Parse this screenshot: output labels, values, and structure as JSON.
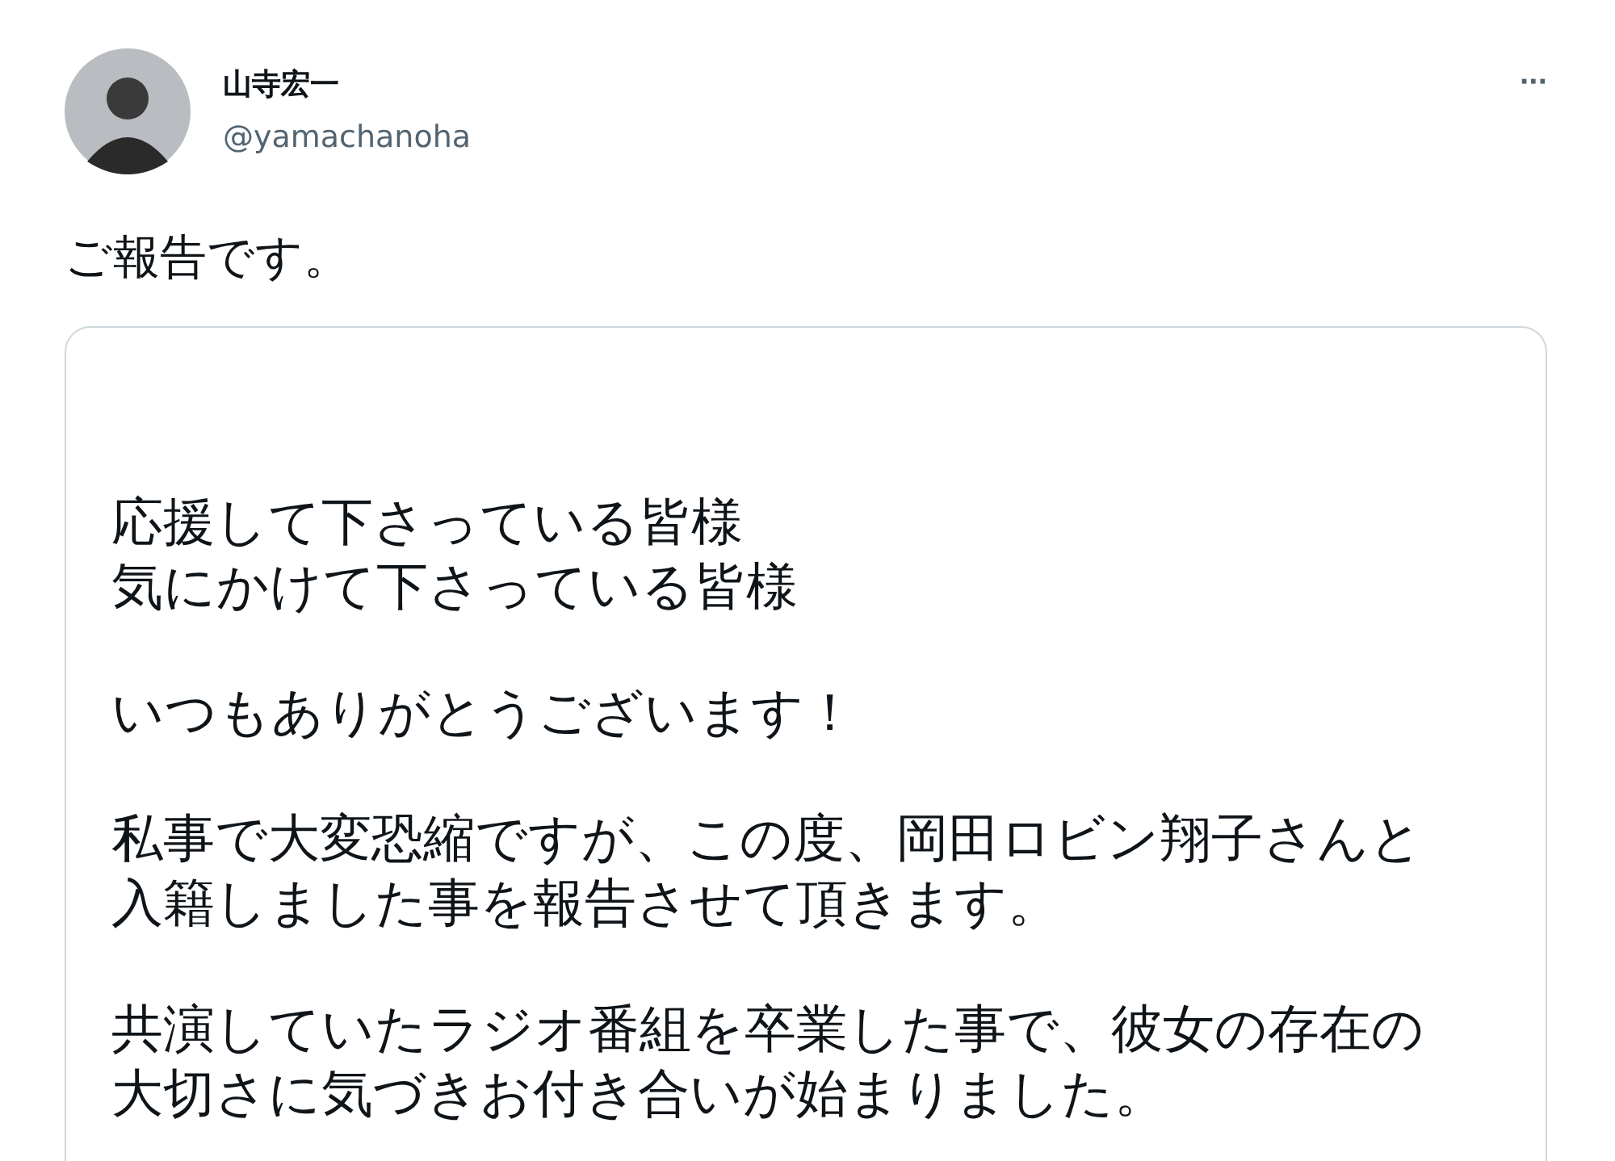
{
  "author": {
    "name": "山寺宏一",
    "handle": "@yamachanoha"
  },
  "more_button": {
    "label": "···"
  },
  "tweet_text": "ご報告です。",
  "attachment": {
    "paragraphs": [
      [
        "応援して下さっている皆様",
        "気にかけて下さっている皆様"
      ],
      [
        "いつもありがとうございます！"
      ],
      [
        "私事で大変恐縮ですが、この度、岡田ロビン翔子さんと",
        "入籍しました事を報告させて頂きます。"
      ],
      [
        "共演していたラジオ番組を卒業した事で、彼女の存在の",
        "大切さに気づきお付き合いが始まりました。"
      ]
    ]
  }
}
